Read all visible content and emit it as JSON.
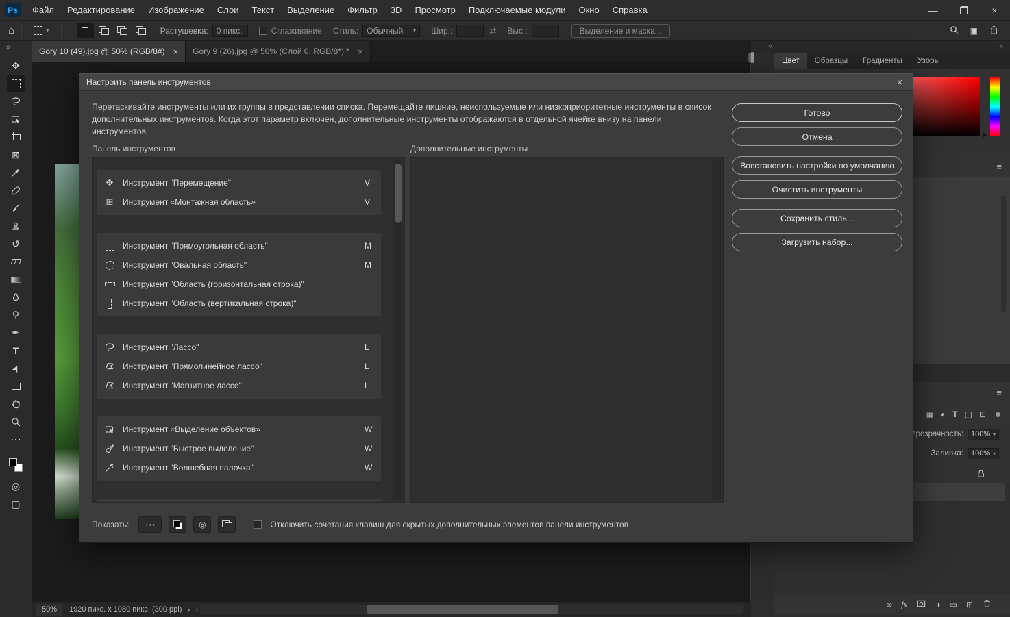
{
  "window": {
    "logo": "Ps"
  },
  "menubar": {
    "items": [
      "Файл",
      "Редактирование",
      "Изображение",
      "Слои",
      "Текст",
      "Выделение",
      "Фильтр",
      "3D",
      "Просмотр",
      "Подключаемые модули",
      "Окно",
      "Справка"
    ]
  },
  "options_bar": {
    "feather_label": "Растушевка:",
    "feather_value": "0 пикс.",
    "antialias_label": "Сглаживание",
    "style_label": "Стиль:",
    "style_value": "Обычный",
    "width_label": "Шир.:",
    "height_label": "Выс.:",
    "select_and_mask_label": "Выделение и маска..."
  },
  "tabs": [
    {
      "label": "Gory 10 (49).jpg @ 50% (RGB/8#)"
    },
    {
      "label": "Gory 9 (26).jpg @ 50% (Слой 0, RGB/8*) *"
    }
  ],
  "dialog": {
    "title": "Настроить панель инструментов",
    "description": "Перетаскивайте инструменты или их группы в представлении списка. Перемещайте лишние, неиспользуемые или низкоприоритетные инструменты в список дополнительных инструментов. Когда этот параметр включен, дополнительные инструменты отображаются в отдельной ячейке внизу на панели инструментов.",
    "left_list_label": "Панель инструментов",
    "right_list_label": "Дополнительные инструменты",
    "buttons": {
      "done": "Готово",
      "cancel": "Отмена",
      "restore": "Восстановить настройки по умолчанию",
      "clear": "Очистить инструменты",
      "save": "Сохранить стиль...",
      "load": "Загрузить набор..."
    },
    "show_label": "Показать:",
    "disable_shortcuts_label": "Отключить сочетания клавиш для скрытых дополнительных элементов панели инструментов",
    "groups": [
      {
        "tools": [
          {
            "name": "Инструмент \"Перемещение\"",
            "key": "V"
          },
          {
            "name": "Инструмент «Монтажная область»",
            "key": "V"
          }
        ]
      },
      {
        "tools": [
          {
            "name": "Инструмент \"Прямоугольная область\"",
            "key": "M"
          },
          {
            "name": "Инструмент \"Овальная область\"",
            "key": "M"
          },
          {
            "name": "Инструмент \"Область (горизонтальная строка)\"",
            "key": ""
          },
          {
            "name": "Инструмент \"Область (вертикальная строка)\"",
            "key": ""
          }
        ]
      },
      {
        "tools": [
          {
            "name": "Инструмент \"Лассо\"",
            "key": "L"
          },
          {
            "name": "Инструмент \"Прямолинейное лассо\"",
            "key": "L"
          },
          {
            "name": "Инструмент \"Магнитное лассо\"",
            "key": "L"
          }
        ]
      },
      {
        "tools": [
          {
            "name": "Инструмент «Выделение объектов»",
            "key": "W"
          },
          {
            "name": "Инструмент \"Быстрое выделение\"",
            "key": "W"
          },
          {
            "name": "Инструмент \"Волшебная палочка\"",
            "key": "W"
          }
        ]
      }
    ]
  },
  "right_panel": {
    "tabs": [
      "Цвет",
      "Образцы",
      "Градиенты",
      "Узоры"
    ],
    "layers": {
      "opacity_label": "Непрозрачность:",
      "opacity_value": "100%",
      "fill_label": "Заливка:",
      "fill_value": "100%",
      "fx_label": "fx"
    }
  },
  "statusbar": {
    "zoom": "50%",
    "doc_info": "1920 пикс. x 1080 пикс. (300 ppi)"
  },
  "colors": {
    "accent_blue": "#37a3f6"
  }
}
